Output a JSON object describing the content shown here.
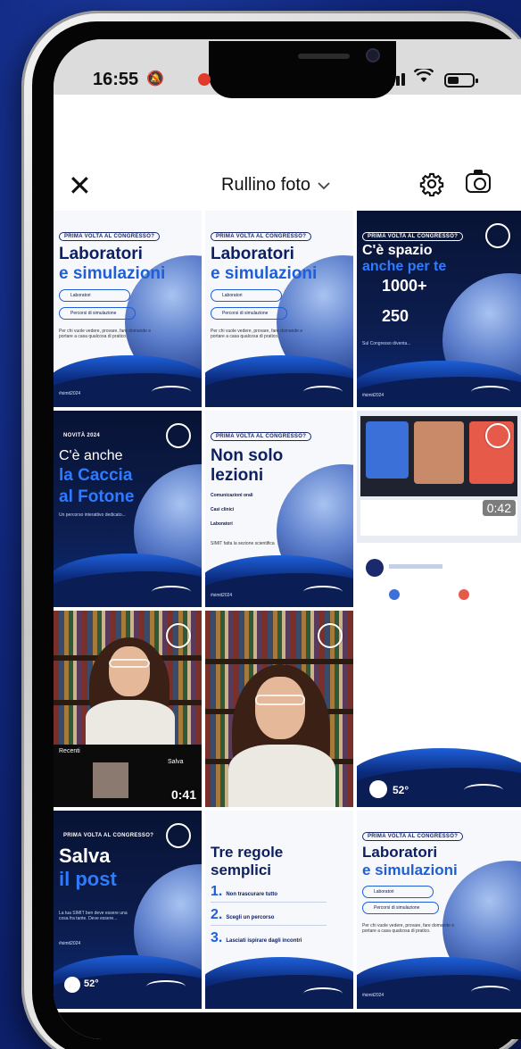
{
  "status_bar": {
    "time": "16:55"
  },
  "header": {
    "title": "Rullino foto"
  },
  "tiles": {
    "t1": {
      "tag": "PRIMA VOLTA AL CONGRESSO?",
      "line1": "Laboratori",
      "line2": "e simulazioni",
      "pill1": "Laboratori",
      "pill2": "Percorsi di simulazione",
      "para": "Per chi vuole vedere, provare, fare domande e portare a casa qualcosa di pratico.",
      "foot": "#simit2024"
    },
    "t2": {
      "tag": "PRIMA VOLTA AL CONGRESSO?",
      "line1": "Laboratori",
      "line2": "e simulazioni",
      "pill1": "Laboratori",
      "pill2": "Percorsi di simulazione",
      "para": "Per chi vuole vedere, provare, fare domande e portare a casa qualcosa di pratico."
    },
    "t3": {
      "tag": "PRIMA VOLTA AL CONGRESSO?",
      "line1": "C'è spazio",
      "line2": "anche per te",
      "num1": "1000+",
      "num2": "250",
      "para": "Sul Congresso diventa...",
      "foot": "#simit2024"
    },
    "t4": {
      "tag": "NOVITÀ 2024",
      "line1": "C'è anche",
      "line2": "la Caccia",
      "line3": "al Fotone",
      "para": "Un percorso interattivo dedicato..."
    },
    "t5": {
      "tag": "PRIMA VOLTA AL CONGRESSO?",
      "line1": "Non solo",
      "line2": "lezioni",
      "item1": "Comunicazioni orali",
      "item2": "Casi clinici",
      "item3": "Laboratori",
      "para": "SIMIT fatta la sezione scientifica",
      "foot": "#simit2024"
    },
    "t6": {
      "duration": "0:42"
    },
    "t7": {
      "duration": "0:41",
      "label": "Recenti",
      "label2": "Salva"
    },
    "t9": {
      "badge": "52°"
    },
    "t10": {
      "tag": "PRIMA VOLTA AL CONGRESSO?",
      "line1": "Salva",
      "line2": "il post",
      "para": "La tua SIMIT ben deve essere una cosa fra tante. Deve essere...",
      "foot": "#simit2024",
      "badge": "52°"
    },
    "t11": {
      "line1": "Tre regole",
      "line2": "semplici",
      "r1n": "1.",
      "r1": "Non trascurare tutto",
      "r2n": "2.",
      "r2": "Scegli un percorso",
      "r3n": "3.",
      "r3": "Lasciati ispirare dagli incontri"
    },
    "t12": {
      "tag": "PRIMA VOLTA AL CONGRESSO?",
      "line1": "Laboratori",
      "line2": "e simulazioni",
      "pill1": "Laboratori",
      "pill2": "Percorsi di simulazione",
      "para": "Per chi vuole vedere, provare, fare domande e portare a casa qualcosa di pratico.",
      "foot": "#simit2024"
    }
  },
  "colors": {
    "accent": "#1e5fd8",
    "navy": "#0e2060",
    "background": "#10277e"
  }
}
